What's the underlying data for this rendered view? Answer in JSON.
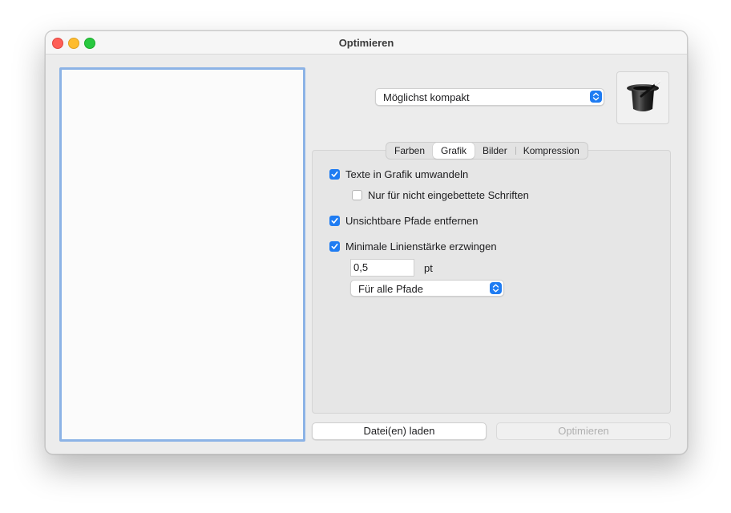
{
  "window": {
    "title": "Optimieren"
  },
  "preset": {
    "selected": "Möglichst kompakt"
  },
  "icon": "magic-hat-icon",
  "tabs": [
    {
      "label": "Farben",
      "active": false
    },
    {
      "label": "Grafik",
      "active": true
    },
    {
      "label": "Bilder",
      "active": false
    },
    {
      "label": "Kompression",
      "active": false
    }
  ],
  "grafik": {
    "text_to_graphics": {
      "label": "Texte in Grafik umwandeln",
      "checked": true
    },
    "only_non_embedded": {
      "label": "Nur für nicht eingebettete Schriften",
      "checked": false
    },
    "remove_invisible_paths": {
      "label": "Unsichtbare Pfade entfernen",
      "checked": true
    },
    "min_line_width": {
      "label": "Minimale Linienstärke erzwingen",
      "checked": true
    },
    "line_width_value": "0,5",
    "line_width_unit": "pt",
    "apply_to": "Für alle Pfade"
  },
  "buttons": {
    "load": "Datei(en) laden",
    "optimize": "Optimieren"
  },
  "colors": {
    "accent": "#1f7cf2",
    "drop_border": "#8cb3e6"
  }
}
